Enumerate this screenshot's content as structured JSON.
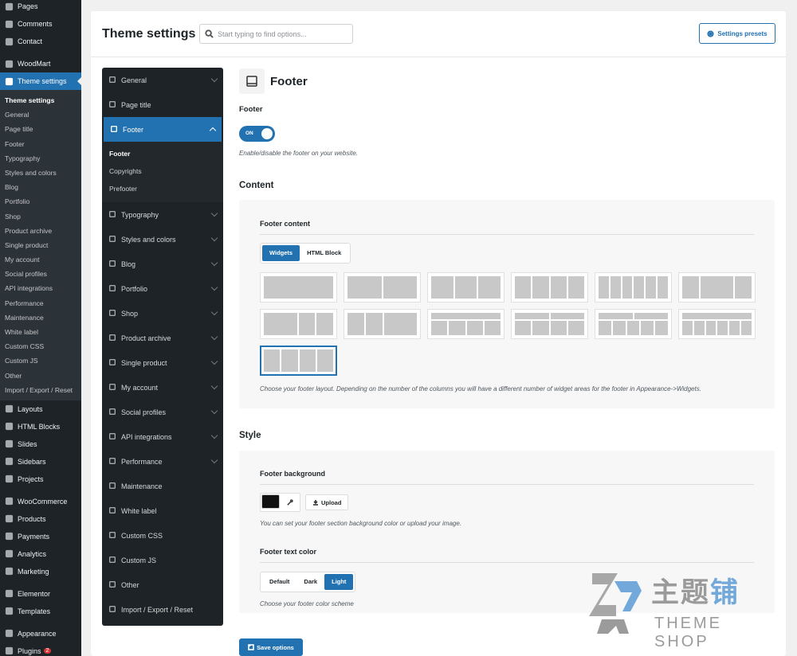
{
  "wp_menu": {
    "top_items": [
      {
        "label": "Pages",
        "icon": "pages-icon"
      },
      {
        "label": "Comments",
        "icon": "comments-icon"
      },
      {
        "label": "Contact",
        "icon": "contact-icon"
      }
    ],
    "woodmart": "WoodMart",
    "theme_settings": "Theme settings",
    "submenu": [
      "Theme settings",
      "General",
      "Page title",
      "Footer",
      "Typography",
      "Styles and colors",
      "Blog",
      "Portfolio",
      "Shop",
      "Product archive",
      "Single product",
      "My account",
      "Social profiles",
      "API integrations",
      "Performance",
      "Maintenance",
      "White label",
      "Custom CSS",
      "Custom JS",
      "Other",
      "Import / Export / Reset"
    ],
    "group2": [
      {
        "label": "Layouts",
        "icon": "layouts-icon"
      },
      {
        "label": "HTML Blocks",
        "icon": "html-blocks-icon"
      },
      {
        "label": "Slides",
        "icon": "slides-icon"
      },
      {
        "label": "Sidebars",
        "icon": "sidebars-icon"
      },
      {
        "label": "Projects",
        "icon": "projects-icon"
      }
    ],
    "group3": [
      {
        "label": "WooCommerce",
        "icon": "woocommerce-icon"
      },
      {
        "label": "Products",
        "icon": "products-icon"
      },
      {
        "label": "Payments",
        "icon": "payments-icon"
      },
      {
        "label": "Analytics",
        "icon": "analytics-icon"
      },
      {
        "label": "Marketing",
        "icon": "marketing-icon"
      }
    ],
    "group4": [
      {
        "label": "Elementor",
        "icon": "elementor-icon"
      },
      {
        "label": "Templates",
        "icon": "templates-icon"
      }
    ],
    "group5": [
      {
        "label": "Appearance",
        "icon": "appearance-icon"
      },
      {
        "label": "Plugins",
        "icon": "plugins-icon",
        "badge": "2"
      }
    ]
  },
  "header": {
    "title": "Theme settings",
    "search_placeholder": "Start typing to find options...",
    "presets_label": "Settings presets"
  },
  "settings_nav": {
    "items_before": [
      {
        "label": "General",
        "icon": "general-icon",
        "chevron": true
      },
      {
        "label": "Page title",
        "icon": "page-title-icon",
        "chevron": false
      }
    ],
    "active": {
      "label": "Footer",
      "icon": "footer-icon"
    },
    "active_sub": [
      "Footer",
      "Copyrights",
      "Prefooter"
    ],
    "items_after": [
      {
        "label": "Typography",
        "icon": "typography-icon",
        "chevron": true
      },
      {
        "label": "Styles and colors",
        "icon": "styles-icon",
        "chevron": true
      },
      {
        "label": "Blog",
        "icon": "blog-icon",
        "chevron": true
      },
      {
        "label": "Portfolio",
        "icon": "portfolio-icon",
        "chevron": true
      },
      {
        "label": "Shop",
        "icon": "shop-icon",
        "chevron": true
      },
      {
        "label": "Product archive",
        "icon": "product-archive-icon",
        "chevron": true
      },
      {
        "label": "Single product",
        "icon": "single-product-icon",
        "chevron": true
      },
      {
        "label": "My account",
        "icon": "my-account-icon",
        "chevron": true
      },
      {
        "label": "Social profiles",
        "icon": "social-profiles-icon",
        "chevron": true
      },
      {
        "label": "API integrations",
        "icon": "api-icon",
        "chevron": true
      },
      {
        "label": "Performance",
        "icon": "performance-icon",
        "chevron": true
      },
      {
        "label": "Maintenance",
        "icon": "maintenance-icon",
        "chevron": false
      },
      {
        "label": "White label",
        "icon": "white-label-icon",
        "chevron": false
      },
      {
        "label": "Custom CSS",
        "icon": "custom-css-icon",
        "chevron": false
      },
      {
        "label": "Custom JS",
        "icon": "custom-js-icon",
        "chevron": false
      },
      {
        "label": "Other",
        "icon": "other-icon",
        "chevron": false
      },
      {
        "label": "Import / Export / Reset",
        "icon": "import-export-icon",
        "chevron": false
      }
    ]
  },
  "footer_section": {
    "heading": "Footer",
    "footer_label": "Footer",
    "toggle_text": "ON",
    "toggle_hint": "Enable/disable the footer on your website.",
    "content_heading": "Content",
    "footer_content_label": "Footer content",
    "content_tabs": [
      "Widgets",
      "HTML Block"
    ],
    "content_tab_selected": "Widgets",
    "layouts_hint": "Choose your footer layout. Depending on the number of the columns you will have a different number of widget areas for the footer in Appearance->Widgets.",
    "selected_layout_index": 12,
    "style_heading": "Style",
    "bg_label": "Footer background",
    "bg_color": "#111111",
    "upload_label": "Upload",
    "bg_hint": "You can set your footer section background color or upload your image.",
    "text_color_label": "Footer text color",
    "text_color_options": [
      "Default",
      "Dark",
      "Light"
    ],
    "text_color_selected": "Light",
    "text_color_hint": "Choose your footer color scheme",
    "save_label": "Save options"
  },
  "watermark": {
    "cn_text": "主题",
    "cn_text_blue": "铺",
    "en_text": "THEME SHOP"
  },
  "colors": {
    "accent": "#2271b1",
    "sidebar_bg": "#1d2327"
  }
}
